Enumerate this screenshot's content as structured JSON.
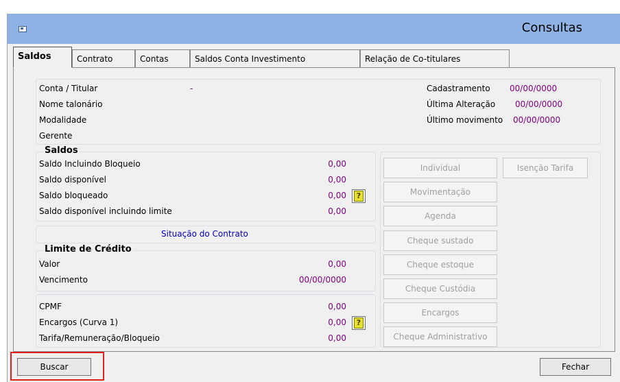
{
  "window": {
    "title": "Consultas"
  },
  "tabs": [
    {
      "label": "Saldos",
      "active": true
    },
    {
      "label": "Contrato"
    },
    {
      "label": "Contas"
    },
    {
      "label": "Saldos Conta Investimento"
    },
    {
      "label": "Relação de Co-titulares"
    }
  ],
  "account": {
    "conta_label": "Conta / Titular",
    "conta_value": "-",
    "nome_label": "Nome talonário",
    "modalidade_label": "Modalidade",
    "gerente_label": "Gerente",
    "cadastramento_label": "Cadastramento",
    "cadastramento_value": "00/00/0000",
    "ultima_alteracao_label": "Última Alteração",
    "ultima_alteracao_value": "00/00/0000",
    "ultimo_mov_label": "Último movimento",
    "ultimo_mov_value": "00/00/0000"
  },
  "saldos": {
    "title": "Saldos",
    "rows": [
      {
        "label": "Saldo Incluindo Bloqueio",
        "value": "0,00"
      },
      {
        "label": "Saldo disponível",
        "value": "0,00"
      },
      {
        "label": "Saldo bloqueado",
        "value": "0,00"
      },
      {
        "label": "Saldo disponível incluindo limite",
        "value": "0,00"
      }
    ]
  },
  "situacao": {
    "label": "Situação do Contrato"
  },
  "limite": {
    "title": "Limite de Crédito",
    "valor_label": "Valor",
    "valor_value": "0,00",
    "vencimento_label": "Vencimento",
    "vencimento_value": "00/00/0000"
  },
  "encargos": {
    "rows": [
      {
        "label": "CPMF",
        "value": "0,00"
      },
      {
        "label": "Encargos (Curva 1)",
        "value": "0,00"
      },
      {
        "label": "Tarifa/Remuneração/Bloqueio",
        "value": "0,00"
      }
    ]
  },
  "side_buttons": [
    "Individual",
    "Movimentação",
    "Agenda",
    "Cheque sustado",
    "Cheque estoque",
    "Cheque Custódia",
    "Encargos",
    "Cheque Administrativo"
  ],
  "isencao_button": "Isenção Tarifa",
  "help_icon_glyph": "?",
  "footer": {
    "buscar_label": "Buscar",
    "fechar_label": "Fechar"
  }
}
